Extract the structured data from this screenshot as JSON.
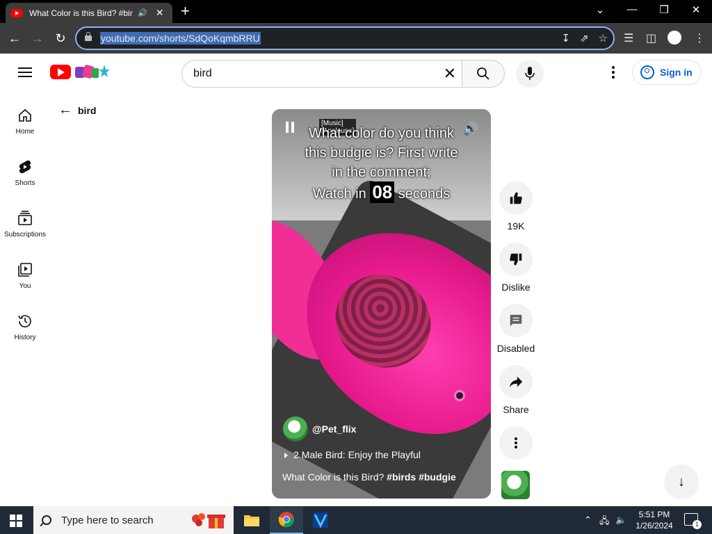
{
  "browser": {
    "tab_title": "What Color is this Bird? #bir",
    "tab_audio_icon": "speaker-icon",
    "new_tab_label": "+",
    "url": "youtube.com/shorts/SdQoKqmbRRU",
    "window_controls": [
      "minimize",
      "restore",
      "close"
    ]
  },
  "youtube": {
    "search_value": "bird",
    "search_placeholder": "Search",
    "sign_in_label": "Sign in",
    "brand_color": "#ff0000",
    "link_color": "#065fd4"
  },
  "sidebar": {
    "items": [
      {
        "label": "Home",
        "icon": "home-icon"
      },
      {
        "label": "Shorts",
        "icon": "shorts-icon"
      },
      {
        "label": "Subscriptions",
        "icon": "subscriptions-icon"
      },
      {
        "label": "You",
        "icon": "library-icon"
      },
      {
        "label": "History",
        "icon": "history-icon"
      }
    ]
  },
  "back": {
    "label": "bird"
  },
  "short": {
    "captions_label": "[Music]\n[Applause]",
    "overlay_lines": [
      "What color do you think",
      "this budgie is? First write",
      "in the comment;"
    ],
    "watch_prefix": "Watch in",
    "watch_count": "08",
    "watch_suffix": "seconds",
    "channel": "@Pet_flix",
    "music": "2 Male Bird: Enjoy the Playful",
    "caption_plain": "What Color is this Bird?",
    "caption_tags": "#birds #budgie"
  },
  "actions": {
    "like_count": "19K",
    "dislike_label": "Dislike",
    "comments_label": "Disabled",
    "share_label": "Share"
  },
  "taskbar": {
    "search_placeholder": "Type here to search",
    "time": "5:51 PM",
    "date": "1/26/2024",
    "notification_count": "1"
  }
}
